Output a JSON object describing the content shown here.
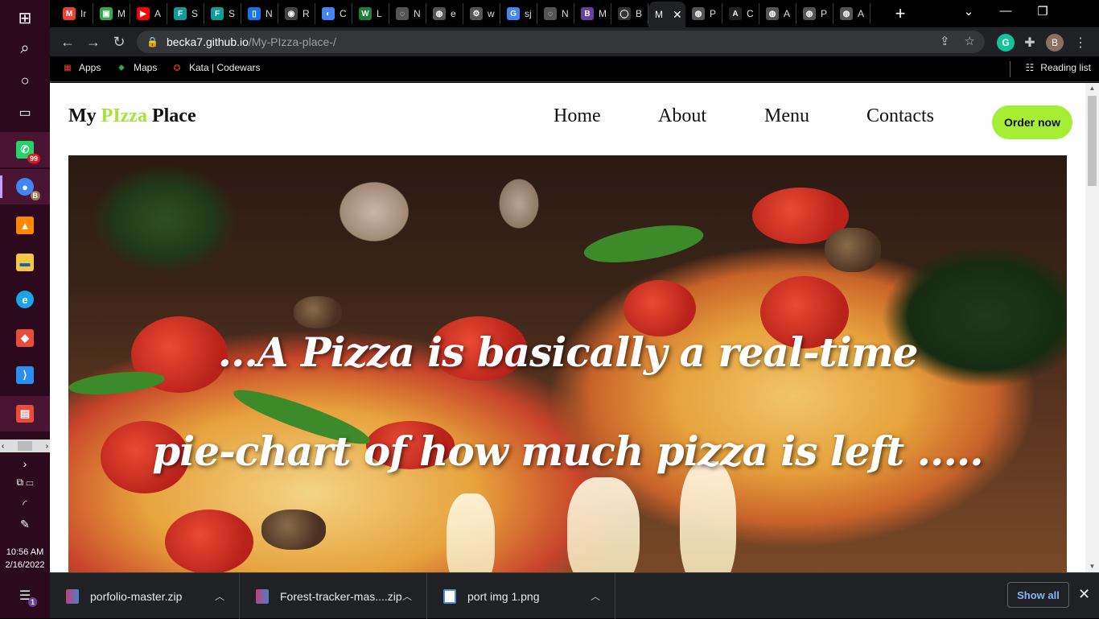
{
  "taskbar": {
    "icons": [
      {
        "name": "windows-start-icon",
        "glyph": "⊞"
      },
      {
        "name": "search-icon",
        "glyph": "⌕"
      },
      {
        "name": "cortana-icon",
        "glyph": "○"
      },
      {
        "name": "task-view-icon",
        "glyph": "▭"
      }
    ],
    "apps": [
      {
        "name": "whatsapp-icon",
        "color": "#25d366",
        "glyph": "✆",
        "badge": "99"
      },
      {
        "name": "chrome-icon",
        "color": "#4285f4",
        "glyph": "●",
        "badge": "B"
      },
      {
        "name": "vlc-icon",
        "color": "#ff8800",
        "glyph": "▲",
        "badge": ""
      },
      {
        "name": "file-explorer-icon",
        "color": "#f2c744",
        "glyph": "▬",
        "badge": ""
      },
      {
        "name": "edge-icon",
        "color": "#1aa3e8",
        "glyph": "e",
        "badge": ""
      },
      {
        "name": "git-icon",
        "color": "#e84c3c",
        "glyph": "◆",
        "badge": ""
      },
      {
        "name": "vscode-icon",
        "color": "#2c8ef0",
        "glyph": "⟩",
        "badge": ""
      },
      {
        "name": "app-window-icon",
        "color": "#e84c3c",
        "glyph": "▤",
        "badge": ""
      }
    ],
    "time": "10:56 AM",
    "date": "2/16/2022",
    "notification_count": "1"
  },
  "tabs": [
    {
      "fav": "M",
      "color": "#ea4335",
      "label": "Ir"
    },
    {
      "fav": "▣",
      "color": "#34a853",
      "label": "M"
    },
    {
      "fav": "▶",
      "color": "#ff0000",
      "label": "A"
    },
    {
      "fav": "F",
      "color": "#0f9d9a",
      "label": "S"
    },
    {
      "fav": "F",
      "color": "#0f9d9a",
      "label": "S"
    },
    {
      "fav": "▯",
      "color": "#1a73e8",
      "label": "N"
    },
    {
      "fav": "◉",
      "color": "#444",
      "label": "R"
    },
    {
      "fav": "◐",
      "color": "#4285f4",
      "label": "C"
    },
    {
      "fav": "W",
      "color": "#1a7f37",
      "label": "L"
    },
    {
      "fav": "◌",
      "color": "#555",
      "label": "N"
    },
    {
      "fav": "◍",
      "color": "#555",
      "label": "e"
    },
    {
      "fav": "⚙",
      "color": "#555",
      "label": "w"
    },
    {
      "fav": "G",
      "color": "#4285f4",
      "label": "sj"
    },
    {
      "fav": "◌",
      "color": "#555",
      "label": "N"
    },
    {
      "fav": "B",
      "color": "#6b3fa0",
      "label": "M"
    },
    {
      "fav": "◯",
      "color": "#333",
      "label": "B"
    }
  ],
  "active_tab": {
    "label": "M"
  },
  "tabs_after": [
    {
      "fav": "◍",
      "color": "#555",
      "label": "P"
    },
    {
      "fav": "A",
      "color": "#222",
      "label": "C"
    },
    {
      "fav": "◍",
      "color": "#555",
      "label": "A"
    },
    {
      "fav": "◍",
      "color": "#555",
      "label": "P"
    },
    {
      "fav": "◍",
      "color": "#555",
      "label": "A"
    }
  ],
  "address": {
    "host": "becka7.github.io",
    "path": "/My-PIzza-place-/"
  },
  "profile_initial": "B",
  "bookmarks": [
    {
      "name": "bookmark-apps",
      "icon": "apps-grid-icon",
      "glyph": "⋮⋮",
      "label": "Apps"
    },
    {
      "name": "bookmark-maps",
      "icon": "maps-pin-icon",
      "glyph": "📍",
      "label": "Maps"
    },
    {
      "name": "bookmark-codewars",
      "icon": "codewars-icon",
      "glyph": "✪",
      "label": "Kata | Codewars"
    }
  ],
  "reading_list": "Reading list",
  "site": {
    "logo_part1": "My ",
    "logo_part2": "PIzza",
    "logo_part3": " Place",
    "nav": [
      "Home",
      "About",
      "Menu",
      "Contacts"
    ],
    "cta": "Order now",
    "quote_line1": "...A Pizza is basically a real-time",
    "quote_line2": "pie-chart of how much pizza is left ....."
  },
  "downloads": [
    {
      "file": "porfolio-master.zip",
      "color": "#c04080"
    },
    {
      "file": "Forest-tracker-mas....zip",
      "color": "#c04080"
    },
    {
      "file": "port img 1.png",
      "color": "#4a90e2"
    }
  ],
  "show_all": "Show all"
}
